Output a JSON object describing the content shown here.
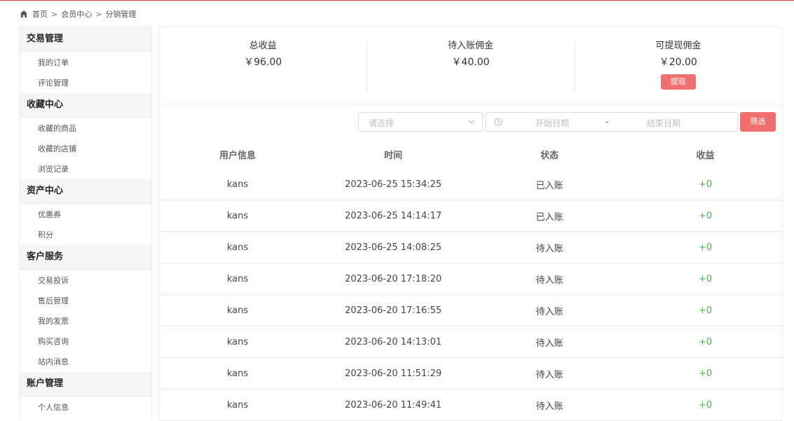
{
  "breadcrumb": {
    "home_icon": "home-icon",
    "items": [
      "首页",
      "会员中心",
      "分销管理"
    ],
    "separator": ">"
  },
  "sidebar": {
    "groups": [
      {
        "title": "交易管理",
        "items": [
          "我的订单",
          "评论管理"
        ]
      },
      {
        "title": "收藏中心",
        "items": [
          "收藏的商品",
          "收藏的店铺",
          "浏览记录"
        ]
      },
      {
        "title": "资产中心",
        "items": [
          "优惠券",
          "积分"
        ]
      },
      {
        "title": "客户服务",
        "items": [
          "交易投诉",
          "售后管理",
          "我的发票",
          "购买咨询",
          "站内消息"
        ]
      },
      {
        "title": "账户管理",
        "items": [
          "个人信息"
        ]
      }
    ]
  },
  "stats": {
    "total": {
      "label": "总收益",
      "value": "￥96.00"
    },
    "pending": {
      "label": "待入账佣金",
      "value": "￥40.00"
    },
    "withdrawable": {
      "label": "可提现佣金",
      "value": "￥20.00",
      "button": "提现"
    }
  },
  "filters": {
    "select_placeholder": "请选择",
    "start_date_placeholder": "开始日期",
    "separator": "-",
    "end_date_placeholder": "结束日期",
    "button": "筛选"
  },
  "table": {
    "headers": [
      "用户信息",
      "时间",
      "状态",
      "收益"
    ],
    "rows": [
      [
        "kans",
        "2023-06-25 15:34:25",
        "已入账",
        "+0"
      ],
      [
        "kans",
        "2023-06-25 14:14:17",
        "已入账",
        "+0"
      ],
      [
        "kans",
        "2023-06-25 14:08:25",
        "待入账",
        "+0"
      ],
      [
        "kans",
        "2023-06-20 17:18:20",
        "待入账",
        "+0"
      ],
      [
        "kans",
        "2023-06-20 17:16:55",
        "待入账",
        "+0"
      ],
      [
        "kans",
        "2023-06-20 14:13:01",
        "待入账",
        "+0"
      ],
      [
        "kans",
        "2023-06-20 11:51:29",
        "待入账",
        "+0"
      ],
      [
        "kans",
        "2023-06-20 11:49:41",
        "待入账",
        "+0"
      ]
    ]
  },
  "colors": {
    "accent": "#f07070",
    "income_green": "#4caf50",
    "top_line": "#e4393c"
  }
}
